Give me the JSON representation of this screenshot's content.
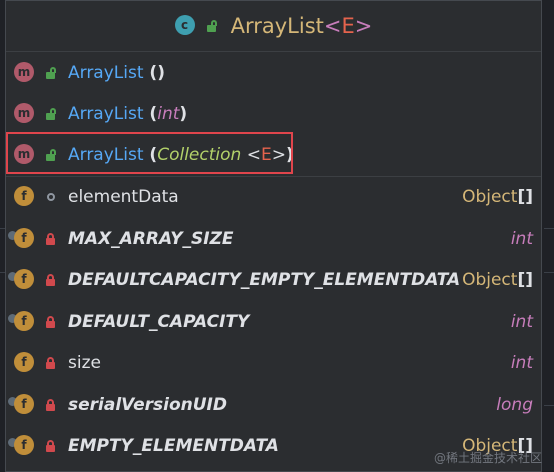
{
  "title": {
    "name": "ArrayList",
    "lt": "<",
    "param": "E",
    "gt": ">"
  },
  "constructors": [
    {
      "name": "ArrayList",
      "open": " (",
      "params": "",
      "close": ")"
    },
    {
      "name": "ArrayList",
      "open": " (",
      "param": "int",
      "close": ")"
    },
    {
      "name": "ArrayList",
      "open": " (",
      "param": "Collection",
      "lt": " <",
      "gparam": "E",
      "gt": ">",
      "close": ")"
    }
  ],
  "fields": [
    {
      "name": "elementData",
      "type": "Object",
      "brackets": " []"
    },
    {
      "name": "MAX_ARRAY_SIZE",
      "type": "int"
    },
    {
      "name": "DEFAULTCAPACITY_EMPTY_ELEMENTDATA",
      "type": "Object",
      "brackets": " []"
    },
    {
      "name": "DEFAULT_CAPACITY",
      "type": "int"
    },
    {
      "name": "size",
      "type": "int"
    },
    {
      "name": "serialVersionUID",
      "type": "long"
    },
    {
      "name": "EMPTY_ELEMENTDATA",
      "type": "Object",
      "brackets": " []"
    }
  ],
  "icons": {
    "class_badge": "c",
    "method_badge": "m",
    "field_badge": "f"
  },
  "colors": {
    "highlight": "#e0454c",
    "class_name": "#d5b778",
    "method": "#56a8f5",
    "keyword_type": "#c77dbb"
  },
  "watermark": "@稀土掘金技术社区"
}
